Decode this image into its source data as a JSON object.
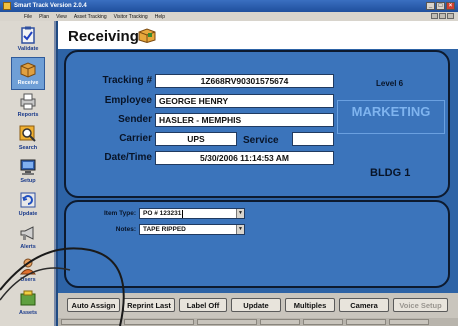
{
  "window": {
    "title": "Smart Track Version 2.0.4",
    "controls": [
      "_",
      "□",
      "×"
    ]
  },
  "menu": {
    "items": [
      "File",
      "Plan",
      "View",
      "Asset Tracking",
      "Visitor Tracking",
      "Help"
    ]
  },
  "sidebar": {
    "items": [
      {
        "label": "Validate",
        "icon": "clipboard-icon"
      },
      {
        "label": "Receive",
        "icon": "package-icon"
      },
      {
        "label": "Reports",
        "icon": "printer-icon"
      },
      {
        "label": "Search",
        "icon": "magnifier-icon"
      },
      {
        "label": "Setup",
        "icon": "computer-icon"
      },
      {
        "label": "Update",
        "icon": "update-icon"
      },
      {
        "label": "Alerts",
        "icon": "megaphone-icon"
      },
      {
        "label": "Users",
        "icon": "user-icon"
      },
      {
        "label": "Assets",
        "icon": "assets-icon"
      }
    ],
    "active": "Receive"
  },
  "page": {
    "title": "Receiving"
  },
  "details": {
    "tracking_label": "Tracking #",
    "tracking_value": "1Z668RV90301575674",
    "employee_label": "Employee",
    "employee_value": "GEORGE HENRY",
    "sender_label": "Sender",
    "sender_value": "HASLER - MEMPHIS",
    "carrier_label": "Carrier",
    "carrier_value": "UPS",
    "service_label": "Service",
    "service_value": "",
    "datetime_label": "Date/Time",
    "datetime_value": "5/30/2006 11:14:53 AM",
    "level": "Level 6",
    "department": "MARKETING",
    "building": "BLDG 1"
  },
  "item": {
    "type_label": "Item Type:",
    "type_value": "PO # 123231",
    "notes_label": "Notes:",
    "notes_value": "TAPE RIPPED"
  },
  "buttons": {
    "auto_assign": "Auto Assign",
    "reprint_last": "Reprint Last",
    "label_off": "Label Off",
    "update": "Update",
    "multiples": "Multiples",
    "camera": "Camera",
    "voice_setup": "Voice Setup"
  },
  "colors": {
    "panel": "#3b74bb",
    "panel_border": "#0d1a2e",
    "department_text": "#7fb4ef",
    "title_bar": "#1f4f9c"
  }
}
